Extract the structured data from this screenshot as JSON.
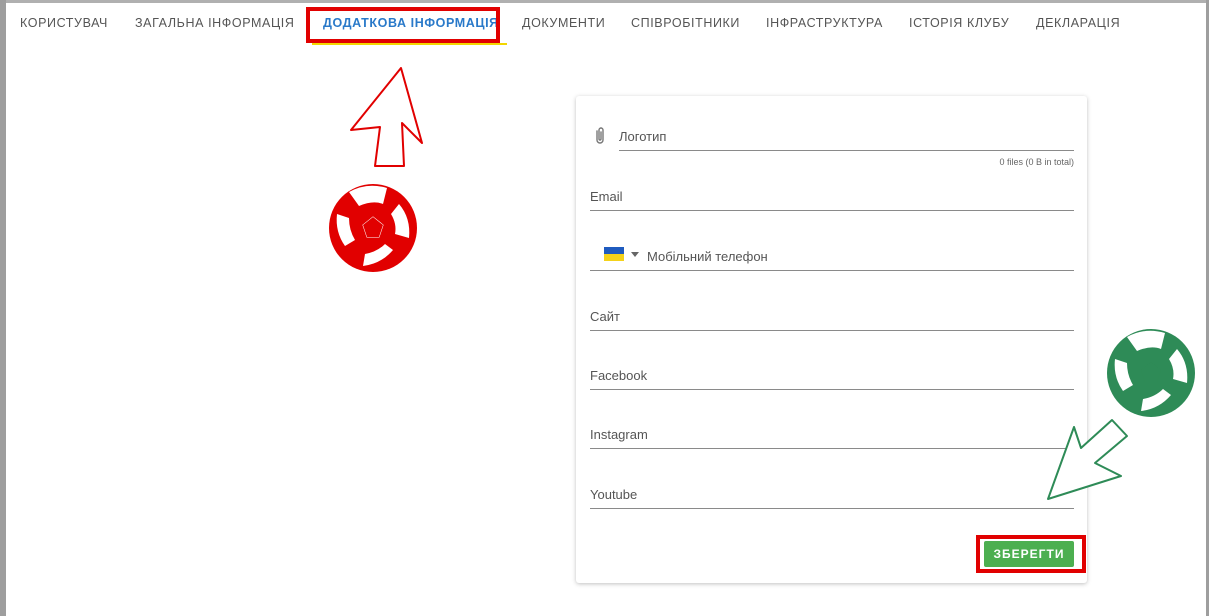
{
  "tabs": [
    {
      "label": "КОРИСТУВАЧ"
    },
    {
      "label": "ЗАГАЛЬНА ІНФОРМАЦІЯ"
    },
    {
      "label": "ДОДАТКОВА ІНФОРМАЦІЯ"
    },
    {
      "label": "ДОКУМЕНТИ"
    },
    {
      "label": "СПІВРОБІТНИКИ"
    },
    {
      "label": "ІНФРАСТРУКТУРА"
    },
    {
      "label": "ІСТОРІЯ КЛУБУ"
    },
    {
      "label": "ДЕКЛАРАЦІЯ"
    }
  ],
  "active_tab": "ДОДАТКОВА ІНФОРМАЦІЯ",
  "form": {
    "logo_label": "Логотип",
    "files_info": "0 files (0 B in total)",
    "email_label": "Email",
    "phone_label": "Мобільний телефон",
    "site_label": "Сайт",
    "facebook_label": "Facebook",
    "instagram_label": "Instagram",
    "youtube_label": "Youtube",
    "save_label": "ЗБЕРЕГТИ"
  },
  "colors": {
    "active_tab": "#2979c9",
    "tab_indicator": "#f2d600",
    "save_button": "#4caf50",
    "highlight": "#e10000",
    "annotation_green": "#2e8b57"
  },
  "icons": {
    "attachment": "paperclip-icon",
    "phone_country": "ukraine-flag-icon",
    "dropdown": "caret-down-icon"
  }
}
